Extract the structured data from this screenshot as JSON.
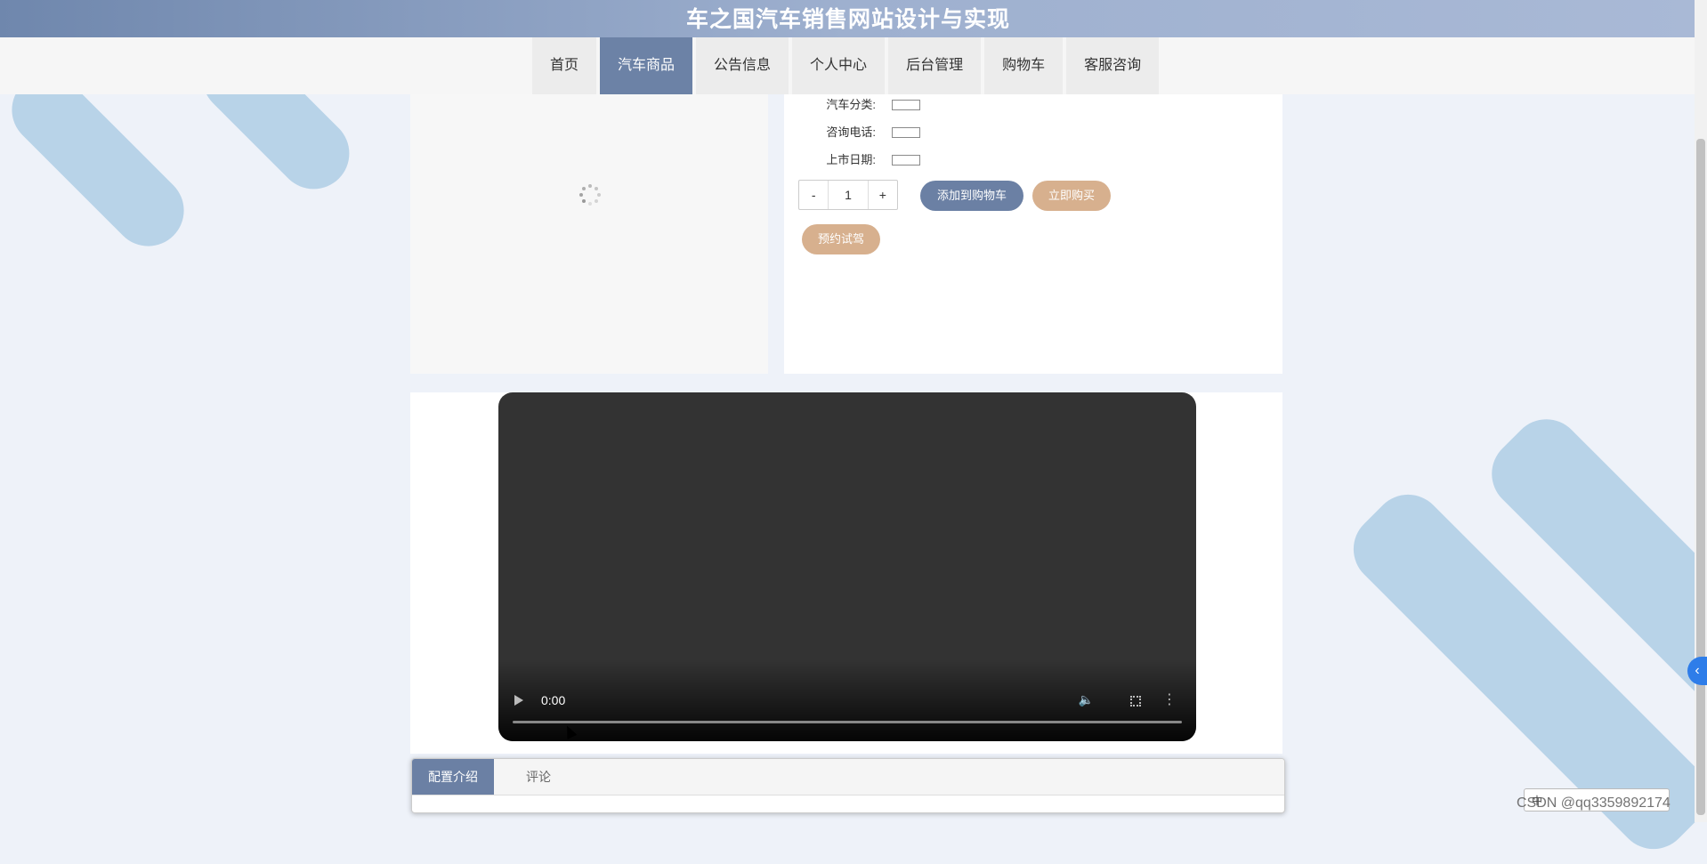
{
  "header": {
    "title": "车之国汽车销售网站设计与实现"
  },
  "nav": {
    "items": [
      {
        "label": "首页",
        "active": false
      },
      {
        "label": "汽车商品",
        "active": true
      },
      {
        "label": "公告信息",
        "active": false
      },
      {
        "label": "个人中心",
        "active": false
      },
      {
        "label": "后台管理",
        "active": false
      },
      {
        "label": "购物车",
        "active": false
      },
      {
        "label": "客服咨询",
        "active": false
      }
    ]
  },
  "product": {
    "fields": [
      {
        "label": "汽车分类:",
        "value": ""
      },
      {
        "label": "咨询电话:",
        "value": ""
      },
      {
        "label": "上市日期:",
        "value": ""
      }
    ],
    "quantity": {
      "minus": "-",
      "value": "1",
      "plus": "+"
    },
    "buttons": {
      "add_to_cart": "添加到购物车",
      "buy_now": "立即购买",
      "test_drive": "预约试驾"
    }
  },
  "video": {
    "time": "0:00"
  },
  "tabs": [
    {
      "label": "配置介绍",
      "active": true
    },
    {
      "label": "评论",
      "active": false
    }
  ],
  "watermark": "CSDN @qq3359892174",
  "widget": {
    "label": "中"
  },
  "colors": {
    "accent": "#6b80a4",
    "secondary": "#d7b08e",
    "background": "#eef2f9",
    "stripe": "#b8d3e8"
  }
}
